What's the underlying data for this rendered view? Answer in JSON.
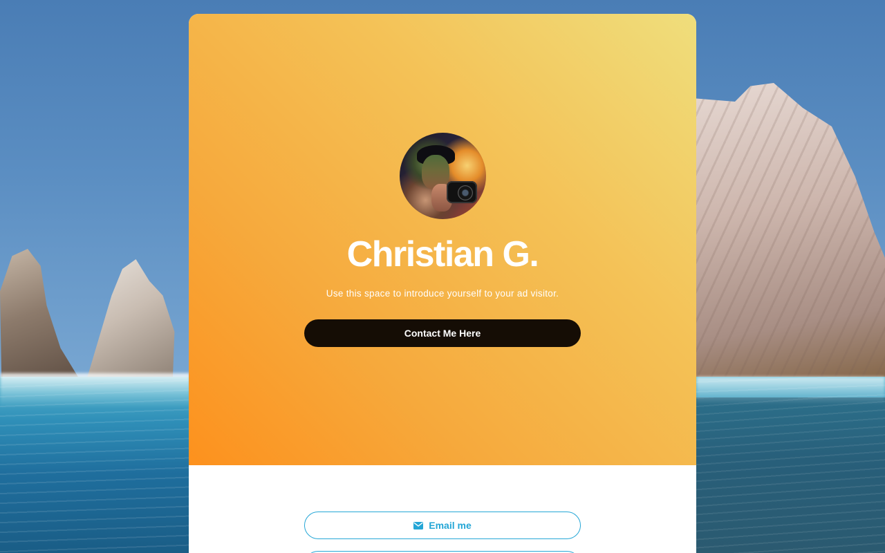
{
  "profile": {
    "name": "Christian G.",
    "tagline": "Use this space to introduce yourself to your ad visitor.",
    "avatar_icon": "camera-photographer-avatar"
  },
  "actions": {
    "contact_label": "Contact Me Here",
    "email_label": "Email me",
    "email_icon": "envelope-icon"
  },
  "colors": {
    "hero_gradient_start": "#fd911d",
    "hero_gradient_end": "#efde7c",
    "contact_button_bg": "#150d05",
    "link_accent": "#24a6d6"
  }
}
